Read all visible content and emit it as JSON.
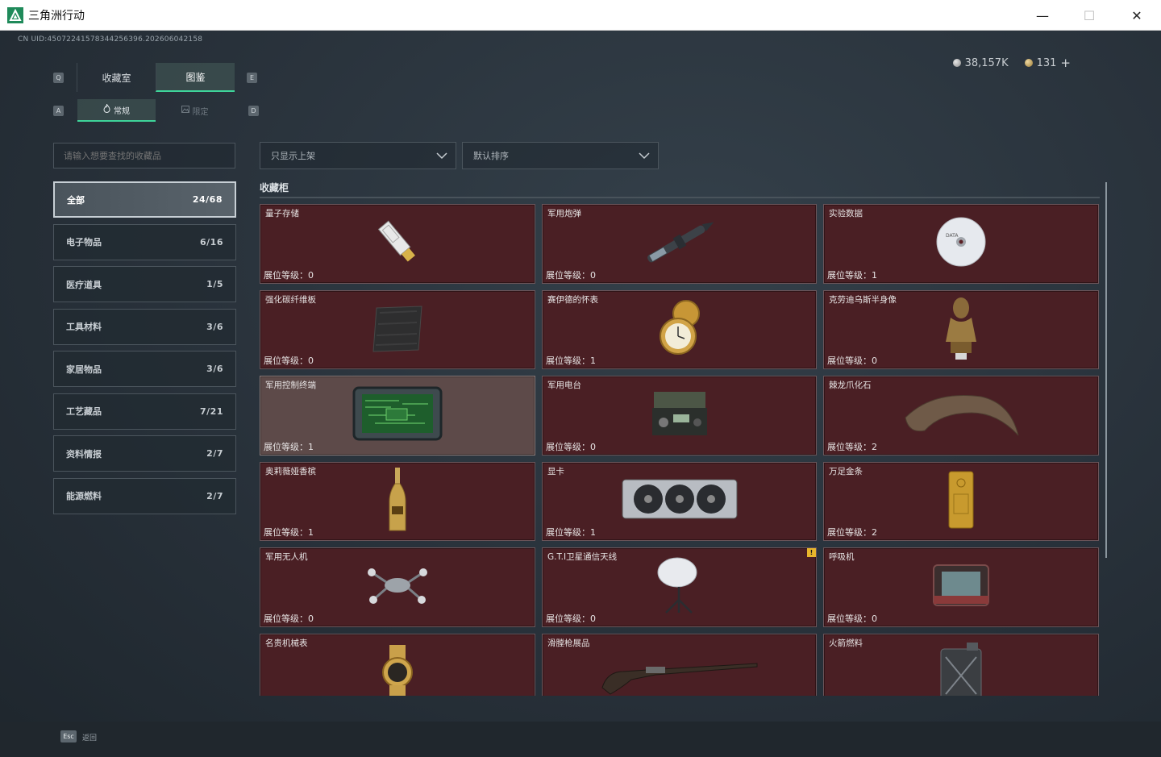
{
  "window": {
    "title": "三角洲行动",
    "minimize": "—",
    "maximize": "☐",
    "close": "✕"
  },
  "uid": "CN UID:450722415783442563​96.202606042158",
  "currency": [
    {
      "icon": "silver-coin-icon",
      "value": "38,157K"
    },
    {
      "icon": "gold-coin-icon",
      "value": "131"
    }
  ],
  "currency_add": "+",
  "key_hints": {
    "left_tab": "Q",
    "right_tab": "E",
    "left_sub": "A",
    "right_sub": "D"
  },
  "tabs": [
    {
      "label": "收藏室",
      "active": false
    },
    {
      "label": "图鉴",
      "active": true
    }
  ],
  "subtabs": [
    {
      "label": "常规",
      "icon": "flame-icon",
      "active": true
    },
    {
      "label": "限定",
      "icon": "image-icon",
      "active": false
    }
  ],
  "search": {
    "placeholder": "请输入想要查找的收藏品"
  },
  "filters": {
    "shelf": "只显示上架",
    "sort": "默认排序"
  },
  "categories": [
    {
      "name": "全部",
      "count": "24/68",
      "active": true
    },
    {
      "name": "电子物品",
      "count": "6/16",
      "active": false
    },
    {
      "name": "医疗道具",
      "count": "1/5",
      "active": false
    },
    {
      "name": "工具材料",
      "count": "3/6",
      "active": false
    },
    {
      "name": "家居物品",
      "count": "3/6",
      "active": false
    },
    {
      "name": "工艺藏品",
      "count": "7/21",
      "active": false
    },
    {
      "name": "资料情报",
      "count": "2/7",
      "active": false
    },
    {
      "name": "能源燃料",
      "count": "2/7",
      "active": false
    }
  ],
  "section_title": "收藏柜",
  "level_prefix": "展位等级：",
  "items": [
    {
      "name": "量子存储",
      "level": "0",
      "icon": "usb-drive-icon"
    },
    {
      "name": "军用炮弹",
      "level": "0",
      "icon": "artillery-shell-icon"
    },
    {
      "name": "实验数据",
      "level": "1",
      "icon": "disc-icon"
    },
    {
      "name": "强化碳纤维板",
      "level": "0",
      "icon": "carbon-plate-icon"
    },
    {
      "name": "赛伊德的怀表",
      "level": "1",
      "icon": "pocket-watch-icon"
    },
    {
      "name": "克劳迪乌斯半身像",
      "level": "0",
      "icon": "bust-icon"
    },
    {
      "name": "军用控制终端",
      "level": "1",
      "icon": "circuit-terminal-icon",
      "hover": true
    },
    {
      "name": "军用电台",
      "level": "0",
      "icon": "radio-icon"
    },
    {
      "name": "棘龙爪化石",
      "level": "2",
      "icon": "claw-fossil-icon"
    },
    {
      "name": "奥莉薇娅香槟",
      "level": "1",
      "icon": "champagne-icon"
    },
    {
      "name": "显卡",
      "level": "1",
      "icon": "graphics-card-icon"
    },
    {
      "name": "万足金条",
      "level": "2",
      "icon": "gold-bar-icon"
    },
    {
      "name": "军用无人机",
      "level": "0",
      "icon": "drone-icon"
    },
    {
      "name": "G.T.I卫星通信天线",
      "level": "0",
      "icon": "satellite-dish-icon",
      "badge": "!"
    },
    {
      "name": "呼吸机",
      "level": "0",
      "icon": "ventilator-icon"
    },
    {
      "name": "名贵机械表",
      "level": "",
      "icon": "wristwatch-icon"
    },
    {
      "name": "滑膛枪展品",
      "level": "",
      "icon": "musket-icon"
    },
    {
      "name": "火箭燃料",
      "level": "",
      "icon": "fuel-can-icon"
    }
  ],
  "bottom": {
    "esc_key": "Esc",
    "esc_label": "返回"
  }
}
